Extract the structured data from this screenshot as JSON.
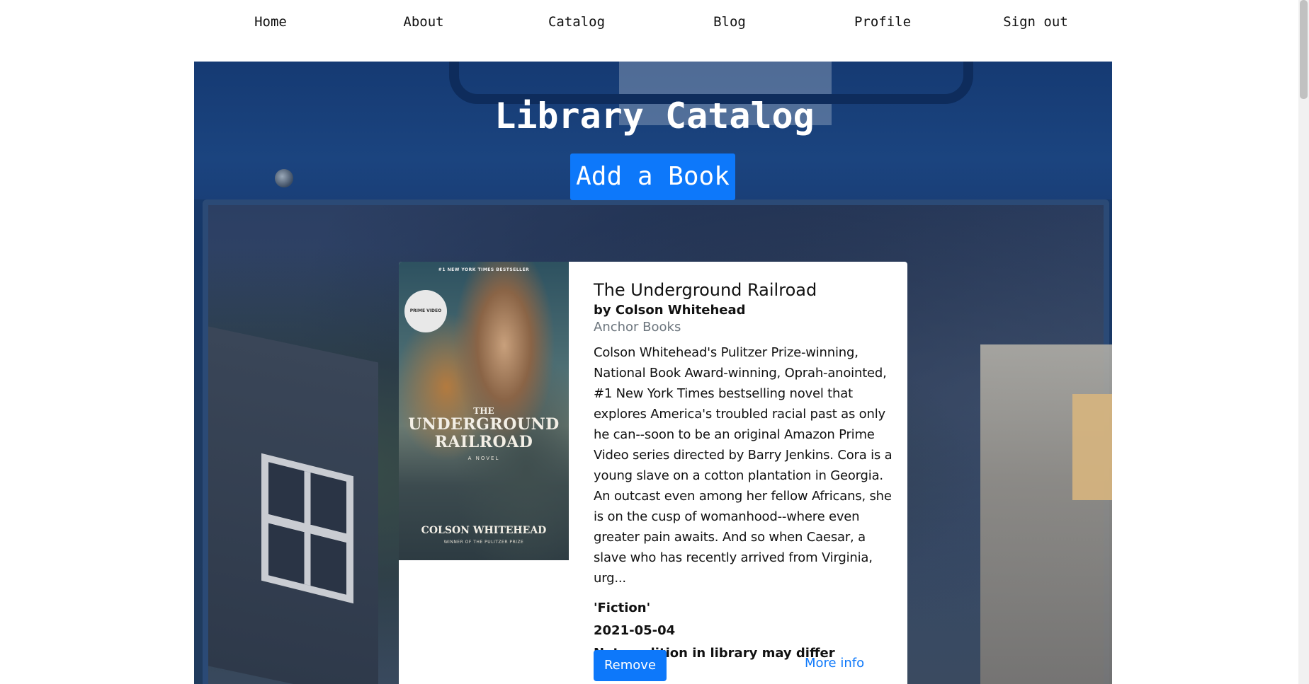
{
  "nav": {
    "items": [
      {
        "label": "Home"
      },
      {
        "label": "About"
      },
      {
        "label": "Catalog"
      },
      {
        "label": "Blog"
      },
      {
        "label": "Profile"
      },
      {
        "label": "Sign out"
      }
    ]
  },
  "hero": {
    "title": "Library Catalog",
    "add_button_label": "Add a Book"
  },
  "book": {
    "title": "The Underground Railroad",
    "author": "by Colson Whitehead",
    "publisher": "Anchor Books",
    "description": "Colson Whitehead's Pulitzer Prize-winning, National Book Award-winning, Oprah-anointed, #1 New York Times bestselling novel that explores America's troubled racial past as only he can--soon to be an original Amazon Prime Video series directed by Barry Jenkins. Cora is a young slave on a cotton plantation in Georgia. An outcast even among her fellow Africans, she is on the cusp of womanhood--where even greater pain awaits. And so when Caesar, a slave who has recently arrived from Virginia, urg...",
    "category": "'Fiction'",
    "date": "2021-05-04",
    "note": "Note: edition in library may differ",
    "remove_label": "Remove",
    "more_info_label": "More info",
    "cover": {
      "top_line": "#1 NEW YORK TIMES BESTSELLER",
      "badge": "PRIME VIDEO",
      "the": "THE",
      "title": "UNDERGROUND RAILROAD",
      "novel": "A NOVEL",
      "author": "COLSON WHITEHEAD",
      "subtitle": "WINNER OF THE PULITZER PRIZE"
    }
  },
  "colors": {
    "accent": "#0d78fa",
    "text": "#111111",
    "muted": "#6c757d"
  }
}
